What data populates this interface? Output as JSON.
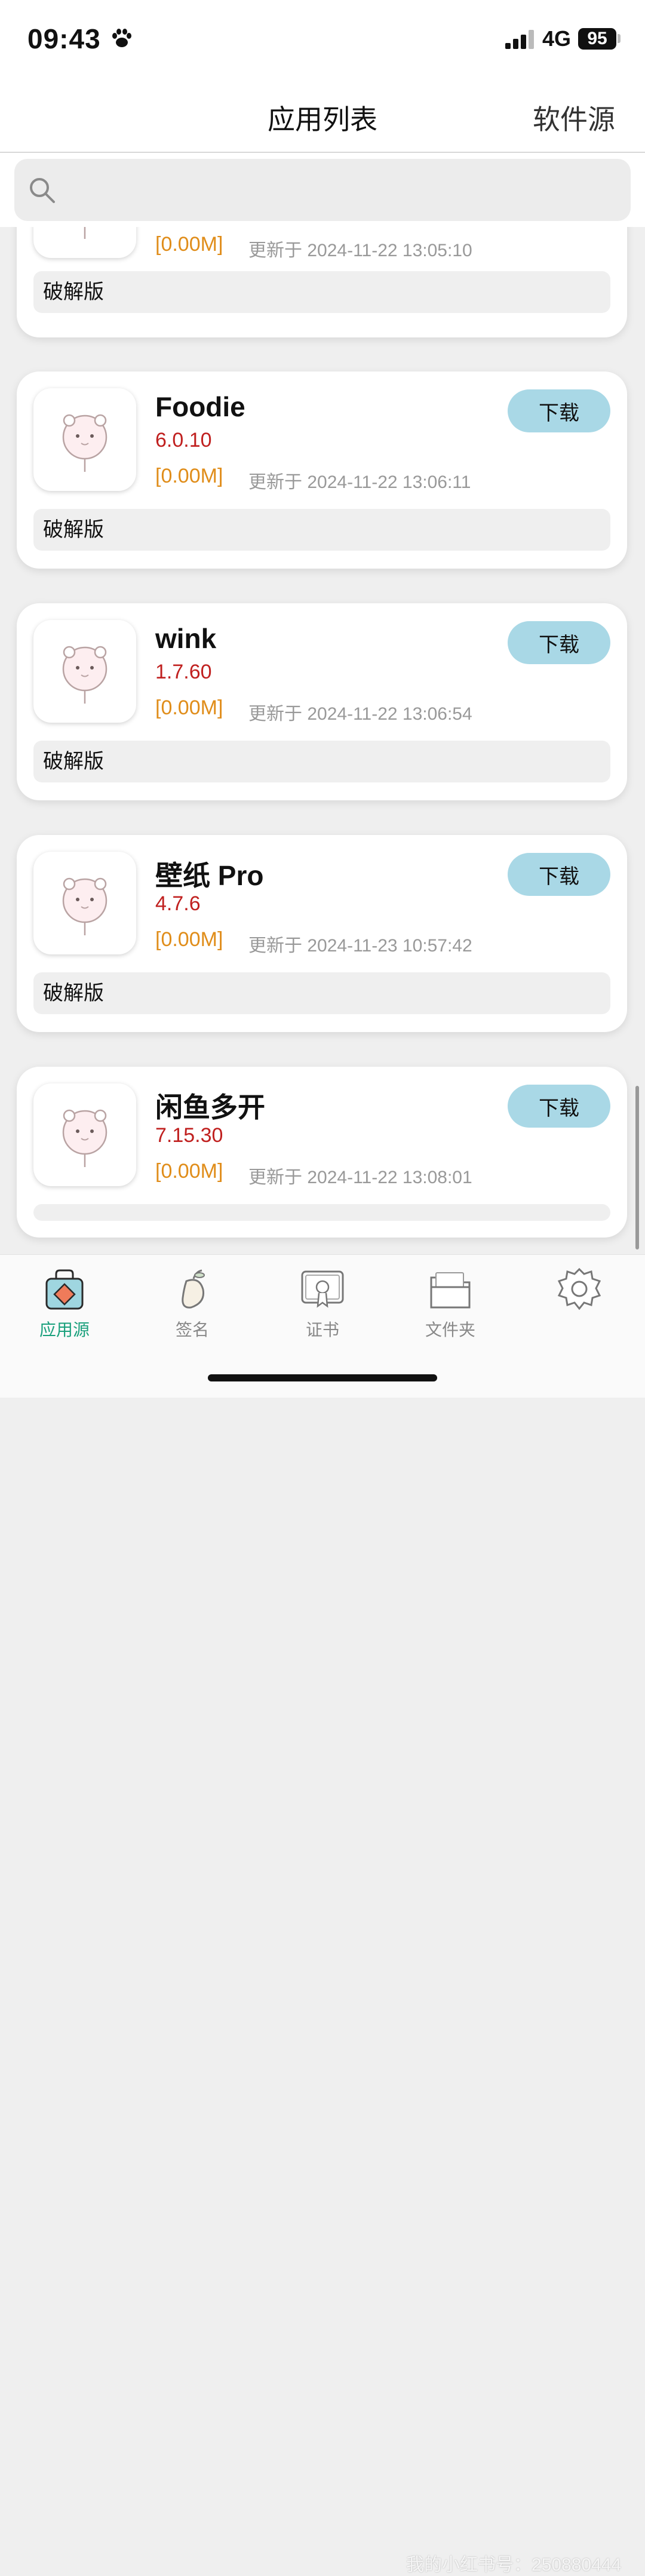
{
  "status": {
    "time": "09:43",
    "network": "4G",
    "battery": "95"
  },
  "nav": {
    "title": "应用列表",
    "right": "软件源"
  },
  "search": {
    "placeholder": ""
  },
  "apps": [
    {
      "name": "",
      "version": "",
      "size": "[0.00M]",
      "updated": "更新于 2024-11-22 13:05:10",
      "tag": "破解版",
      "download": ""
    },
    {
      "name": "Foodie",
      "version": "6.0.10",
      "size": "[0.00M]",
      "updated": "更新于 2024-11-22 13:06:11",
      "tag": "破解版",
      "download": "下载"
    },
    {
      "name": "wink",
      "version": "1.7.60",
      "size": "[0.00M]",
      "updated": "更新于 2024-11-22 13:06:54",
      "tag": "破解版",
      "download": "下载"
    },
    {
      "name": "壁纸 Pro",
      "version": "4.7.6",
      "size": "[0.00M]",
      "updated": "更新于 2024-11-23 10:57:42",
      "tag": "破解版",
      "download": "下载"
    },
    {
      "name": "闲鱼多开",
      "version": "7.15.30",
      "size": "[0.00M]",
      "updated": "更新于 2024-11-22 13:08:01",
      "tag": "",
      "download": "下载"
    }
  ],
  "tabs": [
    {
      "label": "应用源",
      "icon": "app-source-icon",
      "active": true
    },
    {
      "label": "签名",
      "icon": "sign-icon"
    },
    {
      "label": "证书",
      "icon": "certificate-icon"
    },
    {
      "label": "文件夹",
      "icon": "folder-icon"
    },
    {
      "label": "",
      "icon": "settings-icon"
    }
  ],
  "watermark": "我的小红书号：250880444",
  "colors": {
    "accent": "#19a07c",
    "download_bg": "#a9d8e6",
    "version": "#c0201f",
    "size": "#e08d1a"
  }
}
